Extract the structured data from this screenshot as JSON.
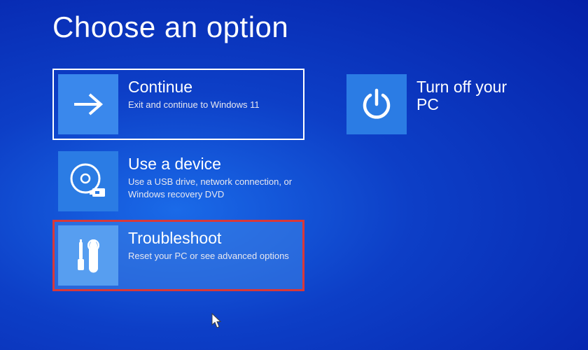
{
  "page": {
    "title": "Choose an option"
  },
  "tiles": {
    "continue": {
      "title": "Continue",
      "desc": "Exit and continue to Windows 11"
    },
    "use_device": {
      "title": "Use a device",
      "desc": "Use a USB drive, network connection, or Windows recovery DVD"
    },
    "troubleshoot": {
      "title": "Troubleshoot",
      "desc": "Reset your PC or see advanced options"
    },
    "turn_off": {
      "title": "Turn off your PC"
    }
  }
}
